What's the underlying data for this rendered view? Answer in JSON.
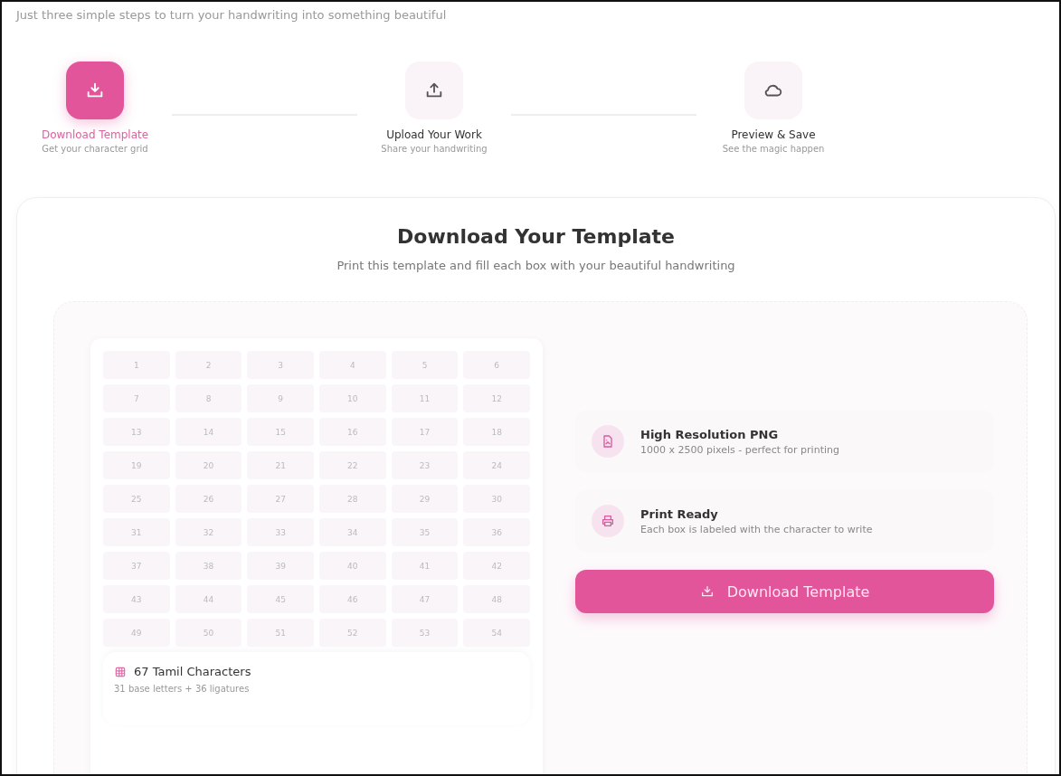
{
  "intro": "Just three simple steps to turn your handwriting into something beautiful",
  "steps": [
    {
      "kind": "download",
      "title": "Download Template",
      "subtitle": "Get your character grid",
      "selected": true
    },
    {
      "kind": "upload",
      "title": "Upload Your Work",
      "subtitle": "Share your handwriting",
      "selected": false
    },
    {
      "kind": "cloud",
      "title": "Preview & Save",
      "subtitle": "See the magic happen",
      "selected": false
    }
  ],
  "panel": {
    "title": "Download Your Template",
    "subtitle": "Print this template and fill each box with your beautiful handwriting",
    "grid_cells": [
      "1",
      "2",
      "3",
      "4",
      "5",
      "6",
      "7",
      "8",
      "9",
      "10",
      "11",
      "12",
      "13",
      "14",
      "15",
      "16",
      "17",
      "18",
      "19",
      "20",
      "21",
      "22",
      "23",
      "24",
      "25",
      "26",
      "27",
      "28",
      "29",
      "30",
      "31",
      "32",
      "33",
      "34",
      "35",
      "36",
      "37",
      "38",
      "39",
      "40",
      "41",
      "42",
      "43",
      "44",
      "45",
      "46",
      "47",
      "48",
      "49",
      "50",
      "51",
      "52",
      "53",
      "54"
    ],
    "grid_info": {
      "title": "67 Tamil Characters",
      "subtitle": "31 base letters + 36 ligatures"
    },
    "features": [
      {
        "kind": "image",
        "title": "High Resolution PNG",
        "subtitle": "1000 x 2500 pixels - perfect for printing"
      },
      {
        "kind": "printer",
        "title": "Print Ready",
        "subtitle": "Each box is labeled with the character to write"
      }
    ],
    "button": "Download Template"
  }
}
